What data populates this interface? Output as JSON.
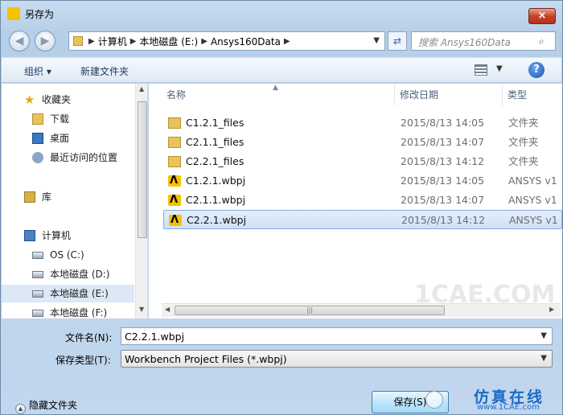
{
  "window": {
    "title": "另存为",
    "close_label": "×"
  },
  "address": {
    "crumbs": [
      "计算机",
      "本地磁盘 (E:)",
      "Ansys160Data"
    ]
  },
  "search": {
    "placeholder": "搜索 Ansys160Data"
  },
  "toolbar": {
    "organize": "组织 ▾",
    "new_folder": "新建文件夹",
    "help": "?"
  },
  "nav": {
    "items": [
      {
        "label": "收藏夹",
        "icon": "star-icon"
      },
      {
        "label": "下载",
        "icon": "folder-icon"
      },
      {
        "label": "桌面",
        "icon": "desktop-icon"
      },
      {
        "label": "最近访问的位置",
        "icon": "recent-icon"
      },
      {
        "label": "库",
        "icon": "library-icon"
      },
      {
        "label": "计算机",
        "icon": "computer-icon"
      },
      {
        "label": "OS (C:)",
        "icon": "drive-icon"
      },
      {
        "label": "本地磁盘 (D:)",
        "icon": "drive-icon"
      },
      {
        "label": "本地磁盘 (E:)",
        "icon": "drive-icon",
        "selected": true
      },
      {
        "label": "本地磁盘 (F:)",
        "icon": "drive-icon"
      }
    ]
  },
  "columns": {
    "name": "名称",
    "date": "修改日期",
    "type": "类型"
  },
  "files": [
    {
      "name": "C1.2.1_files",
      "date": "2015/8/13 14:05",
      "type": "文件夹",
      "icon": "folder-icon"
    },
    {
      "name": "C2.1.1_files",
      "date": "2015/8/13 14:07",
      "type": "文件夹",
      "icon": "folder-icon"
    },
    {
      "name": "C2.2.1_files",
      "date": "2015/8/13 14:12",
      "type": "文件夹",
      "icon": "folder-icon"
    },
    {
      "name": "C1.2.1.wbpj",
      "date": "2015/8/13 14:05",
      "type": "ANSYS v1",
      "icon": "ansys-file-icon"
    },
    {
      "name": "C2.1.1.wbpj",
      "date": "2015/8/13 14:07",
      "type": "ANSYS v1",
      "icon": "ansys-file-icon"
    },
    {
      "name": "C2.2.1.wbpj",
      "date": "2015/8/13 14:12",
      "type": "ANSYS v1",
      "icon": "ansys-file-icon",
      "selected": true
    }
  ],
  "form": {
    "filename_label": "文件名(N):",
    "filename_value": "C2.2.1.wbpj",
    "filetype_label": "保存类型(T):",
    "filetype_value": "Workbench Project Files (*.wbpj)"
  },
  "footer": {
    "hide_folders": "隐藏文件夹",
    "save": "保存(S)"
  },
  "watermark": {
    "center": "1CAE.COM",
    "brand": "仿真在线",
    "url": "www.1CAE.com"
  }
}
